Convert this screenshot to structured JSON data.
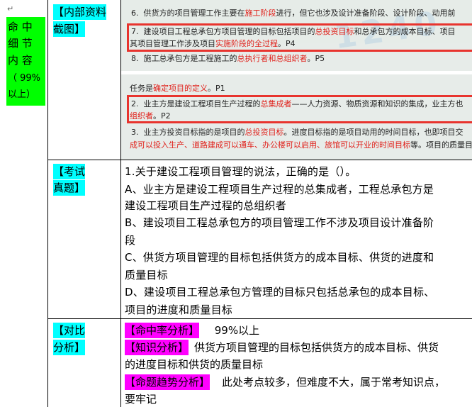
{
  "left_col": {
    "mark": "↵",
    "lines": [
      "命 中",
      "细 节",
      "内 容",
      "（ 99%",
      "以上）"
    ]
  },
  "section1": {
    "label_lines": [
      "【内部资料",
      "截图】"
    ],
    "inset": {
      "lines": [
        {
          "text": "6.  供货方的项目管理工作主要在",
          "red": "施工阶段",
          "rest": "进行，但它也涉及设计准备阶段、设计阶段、动用前"
        },
        {
          "text": "7.  建设项目工程总承包方项目管理的目标包括项目的",
          "red": "总投资目标",
          "rest": "和总承包方的成本目标、项目"
        },
        {
          "text": "其项目管理工作涉及项目",
          "red": "实施阶段的全过程",
          "rest": "。P4"
        },
        {
          "text": "8.  施工总承包方是工程施工的",
          "red": "总执行者和总组织者",
          "rest": "。P5"
        },
        {
          "text": "任务是",
          "red": "确定项目的定义",
          "rest": "。P1"
        },
        {
          "text": "2.  业主方是建设工程项目生产过程的",
          "red": "总集成者",
          "rest": "——人力资源、物质资源和知识的集成，业主方也"
        },
        {
          "text": "",
          "red": "组织者",
          "rest": "。P2"
        },
        {
          "text": "3.  业主方投资目标指的是项目的",
          "red": "总投资目标",
          "rest": "。进度目标指的是项目动用的时间目标，也即项目交"
        },
        {
          "text": "",
          "red": "成可以投入生产、道路建成可以通车、办公楼可以启用、旅馆可以开业的时间目标",
          "rest": "等。项目的质量目"
        }
      ],
      "watermark": "1240"
    }
  },
  "section2": {
    "label_lines": [
      "【考试",
      "真题】"
    ],
    "question_lines": [
      "1.关于建设工程项目管理的说法，正确的是（）。",
      "A、业主方是建设工程项目生产过程的总集成者，工程总承包方是",
      "建设工程项目生产过程的总组织者",
      "B、建设项目工程总承包方的项目管理工作不涉及项目设计准备阶",
      "段",
      "C、供货方项目管理的目标包括供货方的成本目标、供货的进度和",
      "质量目标",
      "D、建设项目工程总承包方管理的目标只包括总承包的成本目标、",
      "项目的进度和质量目标"
    ]
  },
  "section3": {
    "label_lines": [
      "【对比",
      "分析】"
    ],
    "hit_rate_label": "【命中率分析】",
    "hit_rate_value": " 99%以上",
    "knowledge_label": "【知识分析】",
    "knowledge_line1": "供货方项目管理的目标包括供货方的成本目标、供货",
    "knowledge_line2": "的进度目标和供货的质量目标",
    "trend_label": "【命题趋势分析】",
    "trend_line1": "此处考点较多，但难度不大，属于常考知识点，",
    "trend_line2": "要牢记"
  }
}
